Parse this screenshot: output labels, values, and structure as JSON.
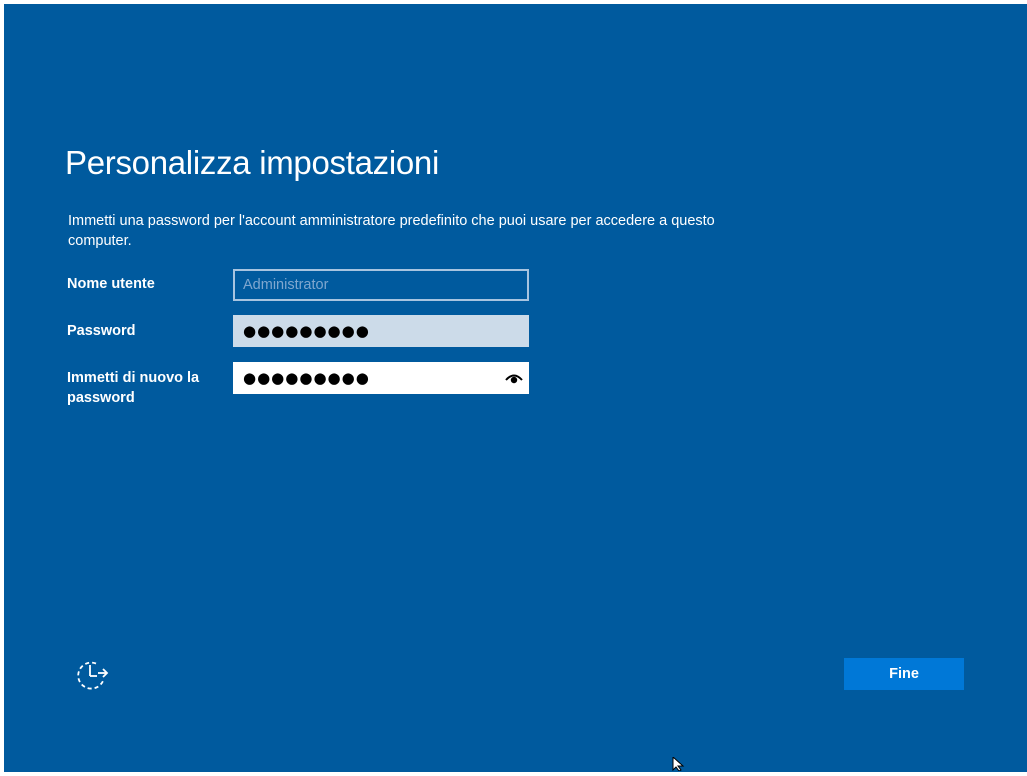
{
  "page": {
    "title": "Personalizza impostazioni",
    "description": "Immetti una password per l'account amministratore predefinito che puoi usare per accedere a questo computer."
  },
  "fields": {
    "username": {
      "label": "Nome utente",
      "value": "",
      "placeholder": "Administrator"
    },
    "password": {
      "label": "Password",
      "masked_value": "●●●●●●●●●"
    },
    "confirm_password": {
      "label": "Immetti di nuovo la password",
      "masked_value": "●●●●●●●●●"
    }
  },
  "icons": {
    "reveal": "eye-icon",
    "accessibility": "ease-of-access-icon"
  },
  "buttons": {
    "finish": "Fine"
  },
  "colors": {
    "background": "#005a9e",
    "button": "#0078d7",
    "password_field": "#ccdbe9",
    "confirm_field": "#ffffff"
  }
}
